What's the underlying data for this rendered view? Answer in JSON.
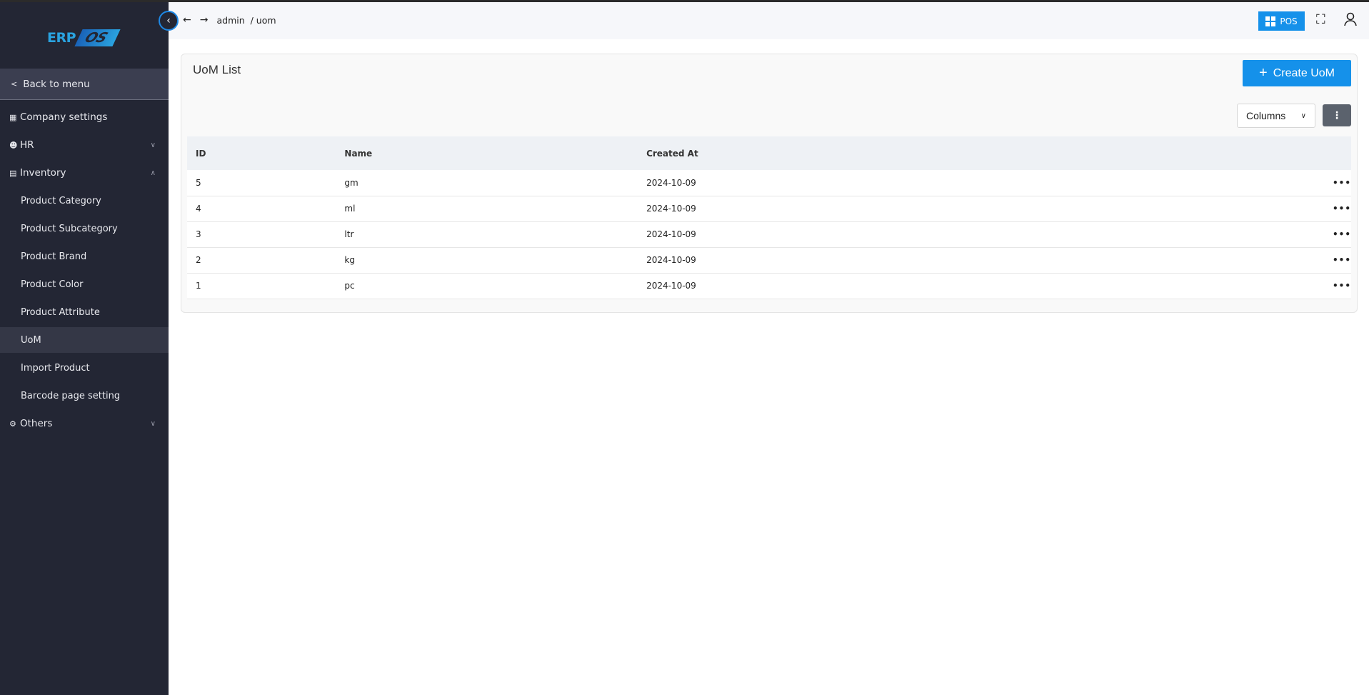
{
  "logo": {
    "text": "ERP",
    "accent": "OS"
  },
  "sidebar": {
    "back_label": "Back to menu",
    "items": [
      {
        "label": "Company settings",
        "icon": "building-icon"
      },
      {
        "label": "HR",
        "icon": "users-icon",
        "chevron": "down"
      },
      {
        "label": "Inventory",
        "icon": "inventory-icon",
        "chevron": "up"
      },
      {
        "label": "Product Category"
      },
      {
        "label": "Product Subcategory"
      },
      {
        "label": "Product Brand"
      },
      {
        "label": "Product Color"
      },
      {
        "label": "Product Attribute"
      },
      {
        "label": "UoM",
        "active": true
      },
      {
        "label": "Import Product"
      },
      {
        "label": "Barcode page setting"
      },
      {
        "label": "Others",
        "icon": "gear-icon",
        "chevron": "down"
      }
    ]
  },
  "header": {
    "breadcrumb_root": "admin",
    "breadcrumb_sep": "/",
    "breadcrumb_page": "uom",
    "pos_label": "POS"
  },
  "main": {
    "title": "UoM List",
    "create_label": "Create UoM",
    "columns_label": "Columns",
    "table": {
      "headers": [
        "ID",
        "Name",
        "Created At"
      ],
      "rows": [
        [
          "5",
          "gm",
          "2024-10-09"
        ],
        [
          "4",
          "ml",
          "2024-10-09"
        ],
        [
          "3",
          "ltr",
          "2024-10-09"
        ],
        [
          "2",
          "kg",
          "2024-10-09"
        ],
        [
          "1",
          "pc",
          "2024-10-09"
        ]
      ]
    }
  },
  "colors": {
    "sidebar": "#232634",
    "accent": "#1591ea"
  }
}
